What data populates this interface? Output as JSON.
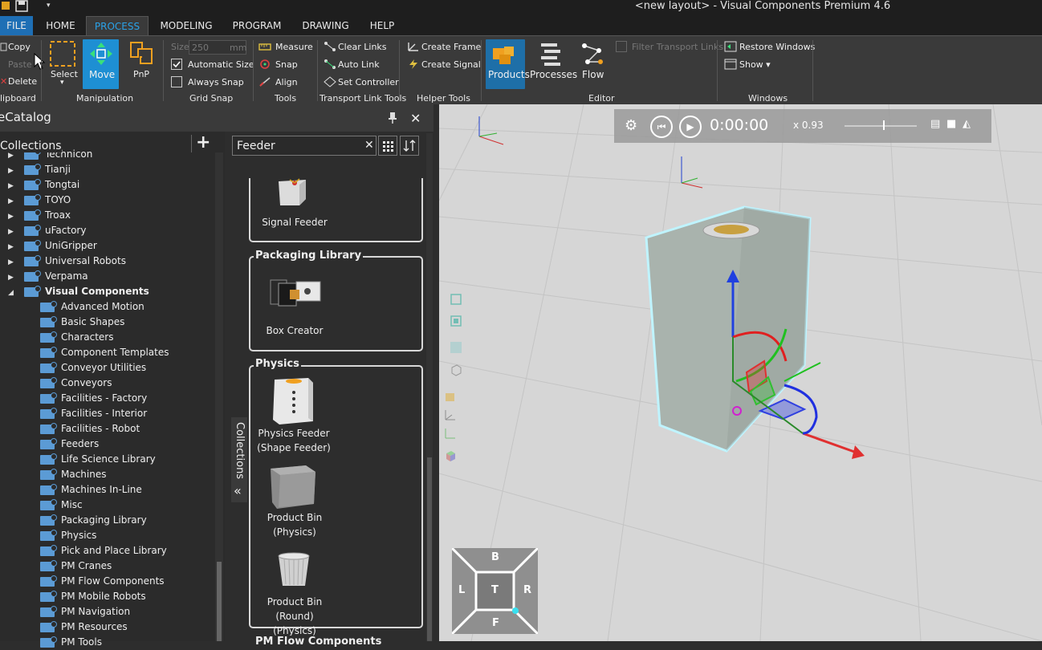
{
  "window": {
    "title": "<new layout> - Visual Components Premium 4.6"
  },
  "menu": {
    "tabs": [
      "FILE",
      "HOME",
      "PROCESS",
      "MODELING",
      "PROGRAM",
      "DRAWING",
      "HELP"
    ],
    "active": "PROCESS"
  },
  "ribbon": {
    "clipboard": {
      "copy": "Copy",
      "paste": "Paste",
      "delete": "Delete",
      "group": "lipboard"
    },
    "manipulation": {
      "select": "Select",
      "move": "Move",
      "pnp": "PnP",
      "group": "Manipulation"
    },
    "gridsnap": {
      "size_label": "Size",
      "size_value": "250",
      "size_unit": "mm",
      "auto_size": "Automatic Size",
      "always_snap": "Always Snap",
      "group": "Grid Snap"
    },
    "tools": {
      "measure": "Measure",
      "snap": "Snap",
      "align": "Align",
      "group": "Tools"
    },
    "transport": {
      "clear_links": "Clear Links",
      "auto_link": "Auto Link",
      "set_controller": "Set Controller",
      "group": "Transport Link Tools"
    },
    "helper": {
      "create_frame": "Create Frame",
      "create_signal": "Create Signal",
      "group": "Helper Tools"
    },
    "editor": {
      "products": "Products",
      "processes": "Processes",
      "flow": "Flow",
      "filter": "Filter Transport Links",
      "group": "Editor"
    },
    "windows": {
      "restore": "Restore Windows",
      "show": "Show ▾",
      "group": "Windows"
    }
  },
  "catalog": {
    "title": "eCatalog",
    "collections_label": "Collections",
    "search_value": "Feeder",
    "side_tab": "Collections",
    "tree": [
      {
        "label": "Technicon",
        "expanded": false,
        "level": 0
      },
      {
        "label": "Tianji",
        "expanded": false,
        "level": 0
      },
      {
        "label": "Tongtai",
        "expanded": false,
        "level": 0
      },
      {
        "label": "TOYO",
        "expanded": false,
        "level": 0
      },
      {
        "label": "Troax",
        "expanded": false,
        "level": 0
      },
      {
        "label": "uFactory",
        "expanded": false,
        "level": 0
      },
      {
        "label": "UniGripper",
        "expanded": false,
        "level": 0
      },
      {
        "label": "Universal Robots",
        "expanded": false,
        "level": 0
      },
      {
        "label": "Verpama",
        "expanded": false,
        "level": 0
      },
      {
        "label": "Visual Components",
        "expanded": true,
        "level": 0
      },
      {
        "label": "Advanced Motion",
        "level": 1
      },
      {
        "label": "Basic Shapes",
        "level": 1
      },
      {
        "label": "Characters",
        "level": 1
      },
      {
        "label": "Component Templates",
        "level": 1
      },
      {
        "label": "Conveyor Utilities",
        "level": 1
      },
      {
        "label": "Conveyors",
        "level": 1
      },
      {
        "label": "Facilities - Factory",
        "level": 1
      },
      {
        "label": "Facilities - Interior",
        "level": 1
      },
      {
        "label": "Facilities - Robot",
        "level": 1
      },
      {
        "label": "Feeders",
        "level": 1
      },
      {
        "label": "Life Science Library",
        "level": 1
      },
      {
        "label": "Machines",
        "level": 1
      },
      {
        "label": "Machines In-Line",
        "level": 1
      },
      {
        "label": "Misc",
        "level": 1
      },
      {
        "label": "Packaging Library",
        "level": 1
      },
      {
        "label": "Physics",
        "level": 1
      },
      {
        "label": "Pick and Place Library",
        "level": 1
      },
      {
        "label": "PM Cranes",
        "level": 1
      },
      {
        "label": "PM Flow Components",
        "level": 1
      },
      {
        "label": "PM Mobile Robots",
        "level": 1
      },
      {
        "label": "PM Navigation",
        "level": 1
      },
      {
        "label": "PM Resources",
        "level": 1
      },
      {
        "label": "PM Tools",
        "level": 1
      }
    ],
    "results": {
      "signal_feeder": "Signal Feeder",
      "packaging_title": "Packaging Library",
      "box_creator": "Box Creator",
      "physics_title": "Physics",
      "physics_feeder": "Physics Feeder (Shape Feeder)",
      "product_bin": "Product Bin (Physics)",
      "product_bin_round": "Product Bin (Round) (Physics)",
      "next_title": "PM Flow Components"
    }
  },
  "viewport": {
    "time": "0:00:00",
    "speed": "x 0.93",
    "navcube": {
      "top": "B",
      "left": "L",
      "center": "T",
      "right": "R",
      "bottom": "F"
    }
  },
  "colors": {
    "accent": "#1e8fd3",
    "move_active": "#1e8fd3",
    "selection_outline": "#bff4ff"
  }
}
